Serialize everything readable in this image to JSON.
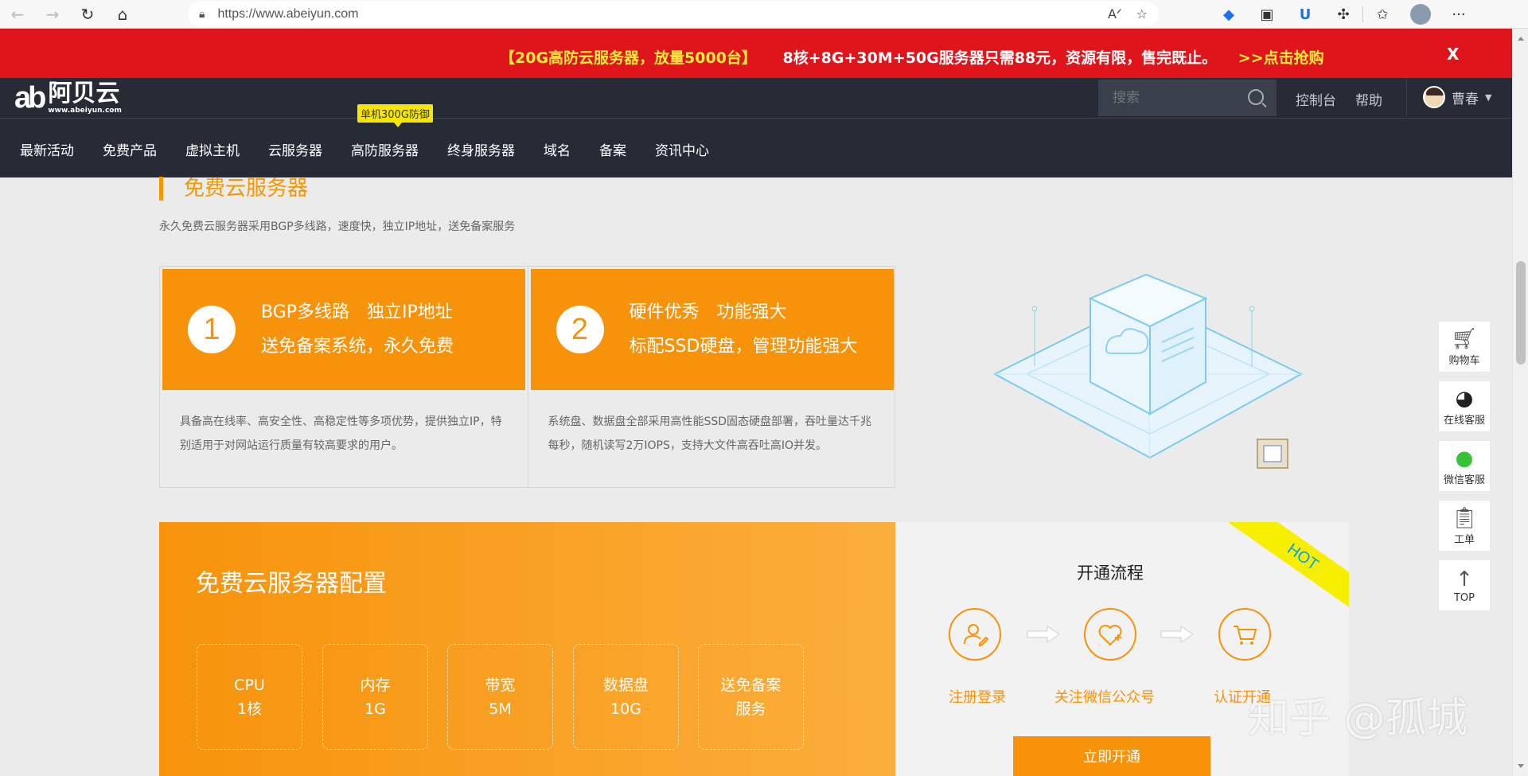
{
  "browser": {
    "url": "https://www.abeiyun.com",
    "icons": [
      "back-icon",
      "forward-icon",
      "refresh-icon",
      "home-icon",
      "lock-icon",
      "read-aloud-icon",
      "add-favorite-icon",
      "extension-icon",
      "favorites-icon",
      "profile-icon",
      "more-icon"
    ]
  },
  "promo": {
    "highlight": "【20G高防云服务器，放量5000台】",
    "main": "8核+8G+30M+50G服务器只需88元，资源有限，售完既止。",
    "cta": ">>点击抢购",
    "close": "X"
  },
  "header": {
    "logo_cn": "阿贝云",
    "logo_url": "www.abeiyun.com",
    "search_placeholder": "搜索",
    "links": [
      "控制台",
      "帮助"
    ],
    "user_name": "曹春",
    "nav": [
      "最新活动",
      "免费产品",
      "虚拟主机",
      "云服务器",
      "高防服务器",
      "终身服务器",
      "域名",
      "备案",
      "资讯中心"
    ],
    "nav_tag": "单机300G防御"
  },
  "section": {
    "title": "免费云服务器",
    "subtitle": "永久免费云服务器采用BGP多线路，速度快，独立IP地址，送免备案服务"
  },
  "features": [
    {
      "num": "1",
      "line1": "BGP多线路　独立IP地址",
      "line2": "送免备案系统，永久免费",
      "desc": "具备高在线率、高安全性、高稳定性等多项优势，提供独立IP，特别适用于对网站运行质量有较高要求的用户。"
    },
    {
      "num": "2",
      "line1": "硬件优秀　功能强大",
      "line2": "标配SSD硬盘，管理功能强大",
      "desc": "系统盘、数据盘全部采用高性能SSD固态硬盘部署，吞吐量达千兆每秒，随机读写2万IOPS，支持大文件高吞吐高IO并发。"
    }
  ],
  "config": {
    "title": "免费云服务器配置",
    "specs": [
      {
        "l1": "CPU",
        "l2": "1核"
      },
      {
        "l1": "内存",
        "l2": "1G"
      },
      {
        "l1": "带宽",
        "l2": "5M"
      },
      {
        "l1": "数据盘",
        "l2": "10G"
      },
      {
        "l1": "送免备案",
        "l2": "服务"
      }
    ]
  },
  "flow": {
    "hot": "HOT",
    "title": "开通流程",
    "steps": [
      "注册登录",
      "关注微信公众号",
      "认证开通"
    ],
    "button": "立即开通"
  },
  "tools": [
    "购物车",
    "在线客服",
    "微信客服",
    "工单",
    "TOP"
  ],
  "watermark": "知乎 @孤城",
  "colors": {
    "accent": "#f7930b",
    "promo_bg": "#e0151b",
    "header_bg": "#262b36",
    "tag_yellow": "#f7e600"
  }
}
